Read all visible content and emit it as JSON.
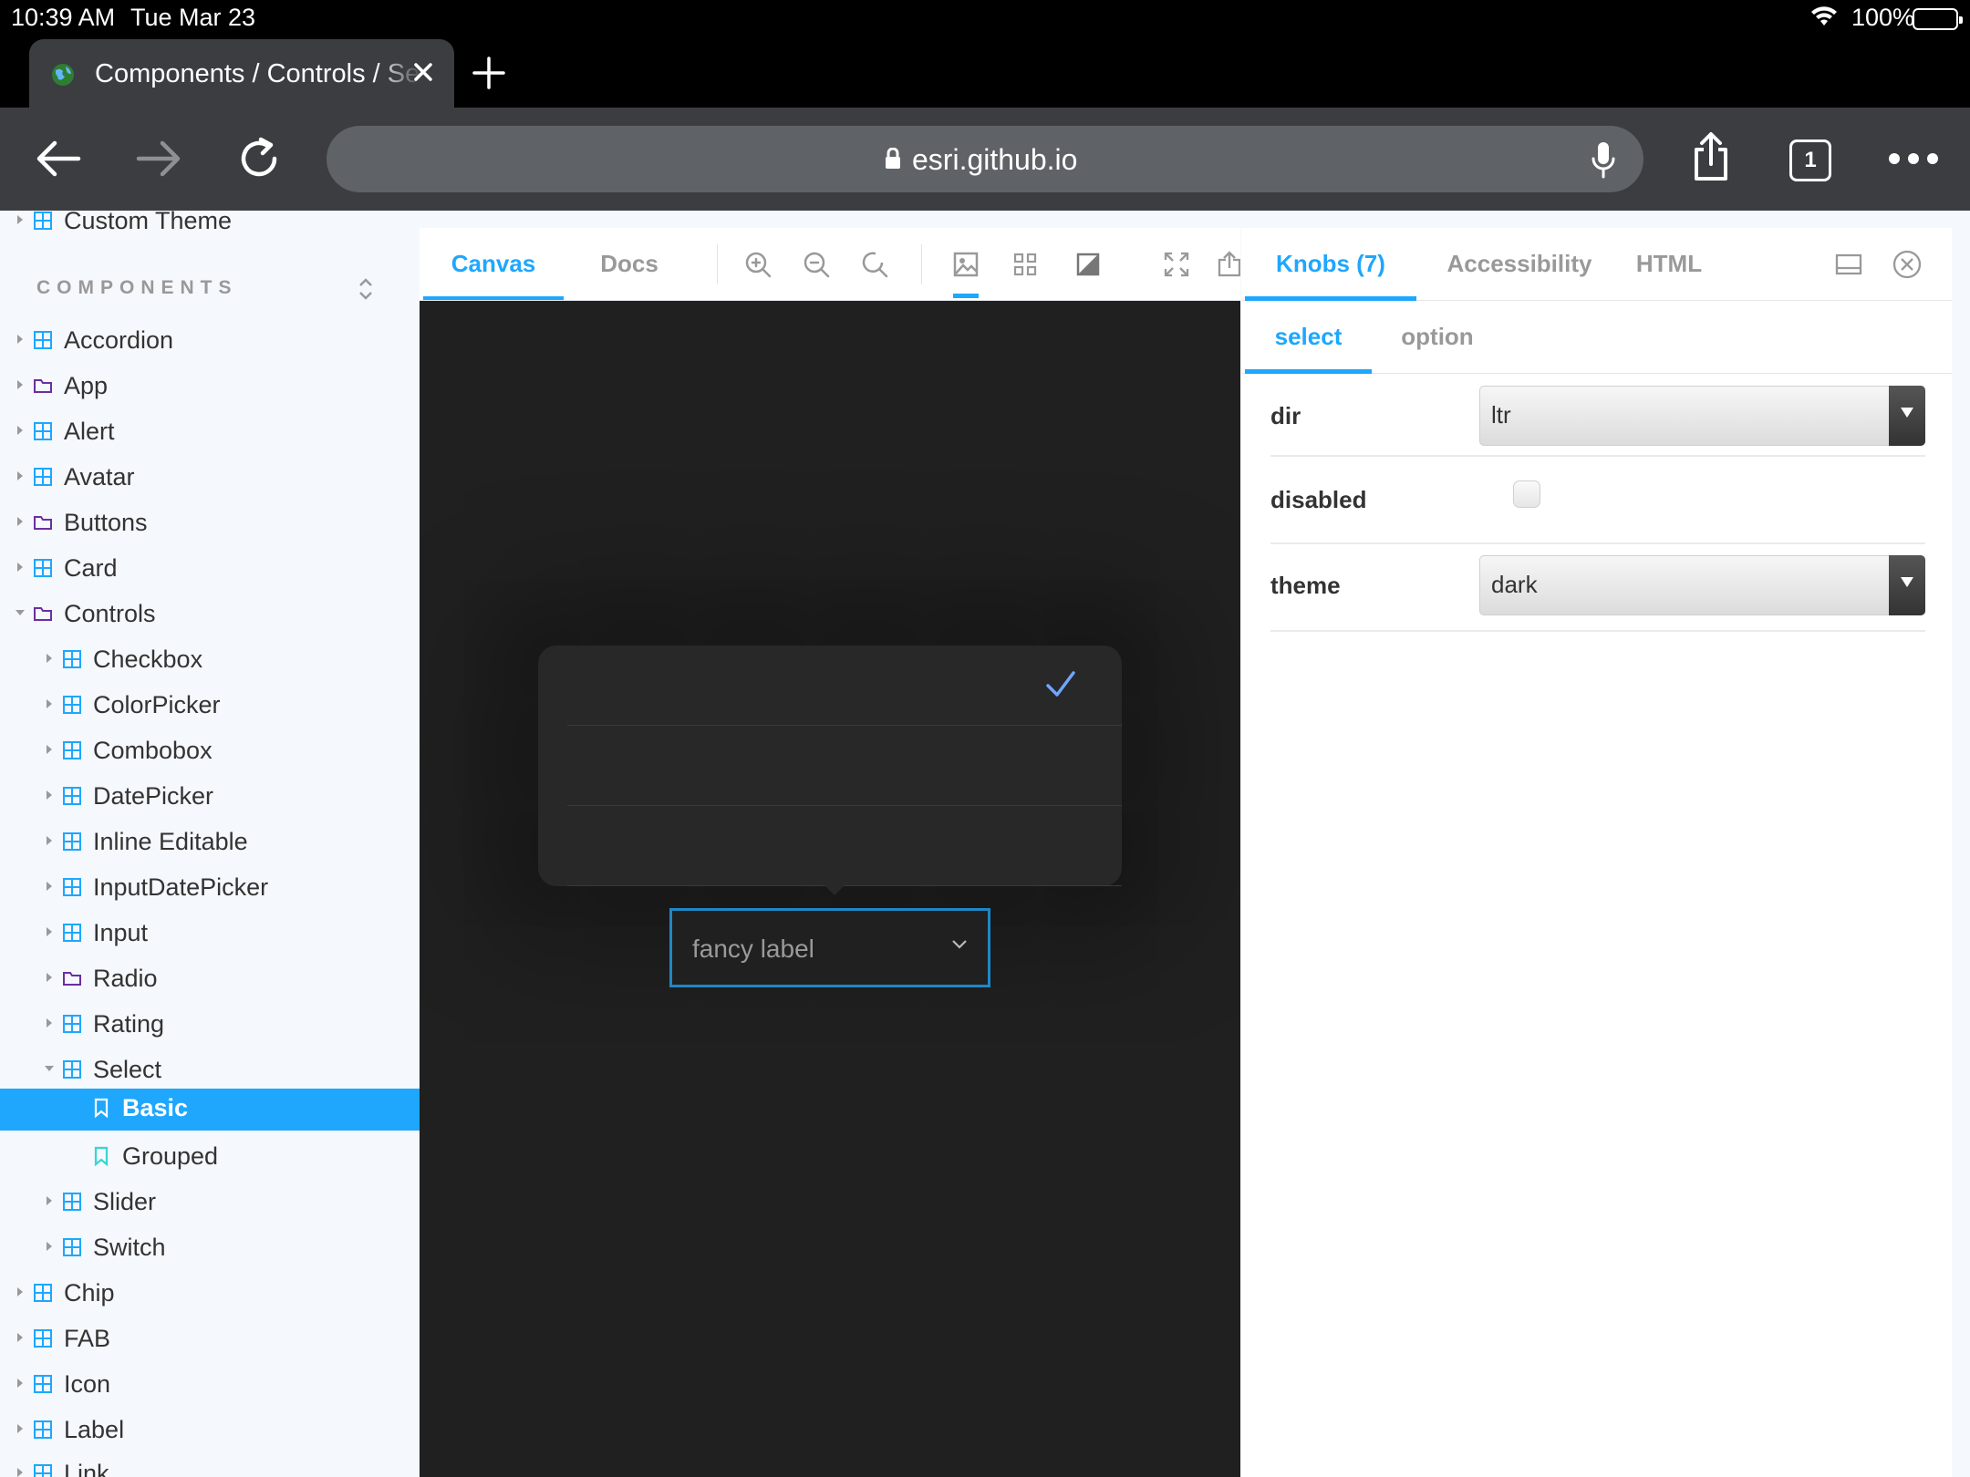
{
  "status_bar": {
    "time": "10:39 AM",
    "date": "Tue Mar 23",
    "battery": "100%"
  },
  "browser": {
    "tab_title": "Components / Controls / Select",
    "url": "esri.github.io",
    "tab_count": "1"
  },
  "sidebar": {
    "partial_top_item": "Custom Theme",
    "section_heading": "COMPONENTS",
    "items": [
      {
        "label": "Accordion"
      },
      {
        "label": "App"
      },
      {
        "label": "Alert"
      },
      {
        "label": "Avatar"
      },
      {
        "label": "Buttons"
      },
      {
        "label": "Card"
      },
      {
        "label": "Controls"
      },
      {
        "label": "Checkbox"
      },
      {
        "label": "ColorPicker"
      },
      {
        "label": "Combobox"
      },
      {
        "label": "DatePicker"
      },
      {
        "label": "Inline Editable"
      },
      {
        "label": "InputDatePicker"
      },
      {
        "label": "Input"
      },
      {
        "label": "Radio"
      },
      {
        "label": "Rating"
      },
      {
        "label": "Select"
      },
      {
        "label": "Basic"
      },
      {
        "label": "Grouped"
      },
      {
        "label": "Slider"
      },
      {
        "label": "Switch"
      },
      {
        "label": "Chip"
      },
      {
        "label": "FAB"
      },
      {
        "label": "Icon"
      },
      {
        "label": "Label"
      },
      {
        "label": "Link"
      }
    ]
  },
  "preview": {
    "tabs": {
      "canvas": "Canvas",
      "docs": "Docs"
    },
    "select_label": "fancy label"
  },
  "addons": {
    "tabs": {
      "knobs": "Knobs (7)",
      "accessibility": "Accessibility",
      "html": "HTML"
    },
    "subtabs": {
      "select": "select",
      "option": "option"
    },
    "knobs": {
      "dir": {
        "label": "dir",
        "value": "ltr"
      },
      "disabled": {
        "label": "disabled"
      },
      "theme": {
        "label": "theme",
        "value": "dark"
      }
    }
  },
  "colors": {
    "accent": "#1ea7fd",
    "canvas_bg": "#202020",
    "select_border": "#1e88c7"
  }
}
